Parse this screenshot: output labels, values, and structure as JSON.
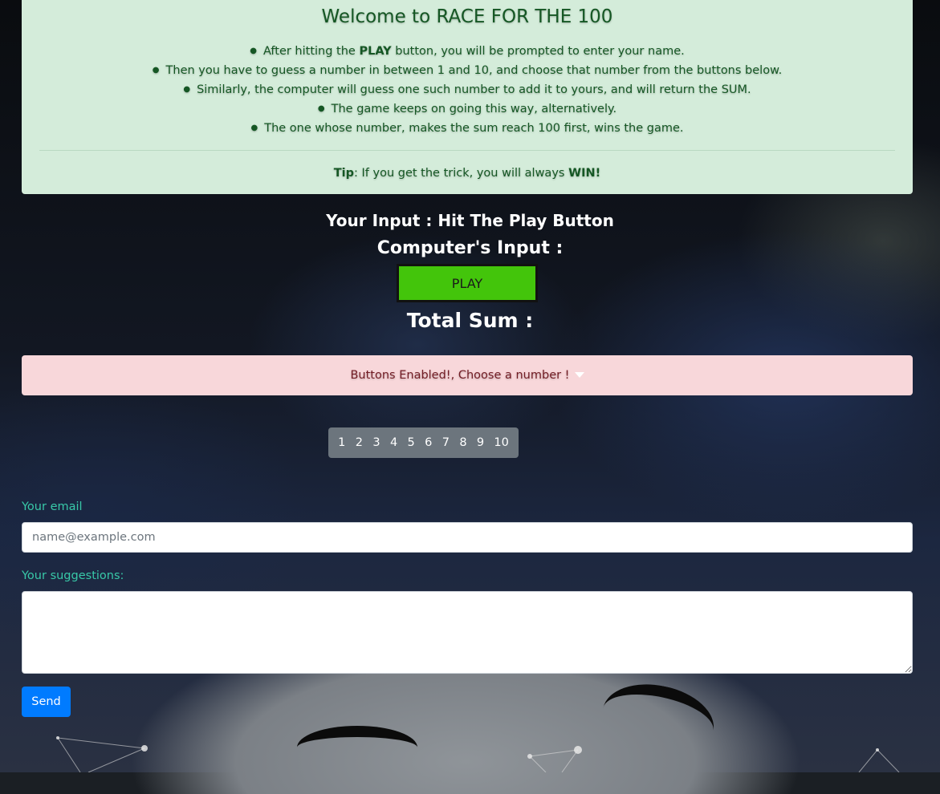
{
  "info": {
    "title": "Welcome to RACE FOR THE 100",
    "rules": [
      {
        "pre": "After hitting the ",
        "bold": "PLAY",
        "post": " button, you will be prompted to enter your name."
      },
      {
        "pre": "Then you have to guess a number in between 1 and 10, and choose that number from the buttons below.",
        "bold": "",
        "post": ""
      },
      {
        "pre": "Similarly, the computer will guess one such number to add it to yours, and will return the SUM.",
        "bold": "",
        "post": ""
      },
      {
        "pre": "The game keeps on going this way, alternatively.",
        "bold": "",
        "post": ""
      },
      {
        "pre": "The one whose number, makes the sum reach 100 first, wins the game.",
        "bold": "",
        "post": ""
      }
    ],
    "tip_label": "Tip",
    "tip_text": ": If you get the trick, you will always ",
    "tip_win": "WIN!"
  },
  "game": {
    "your_input": "Your Input : Hit The Play Button",
    "computer_input": "Computer's Input :",
    "play_label": "PLAY",
    "total_sum": "Total Sum :"
  },
  "alert": {
    "text": "Buttons Enabled!, Choose a number !"
  },
  "numbers": [
    "1",
    "2",
    "3",
    "4",
    "5",
    "6",
    "7",
    "8",
    "9",
    "10"
  ],
  "form": {
    "email_label": "Your email",
    "email_placeholder": "name@example.com",
    "email_value": "",
    "suggestions_label": "Your suggestions:",
    "suggestions_value": "",
    "send_label": "Send"
  },
  "colors": {
    "info_bg": "#d4ecda",
    "info_text": "#155724",
    "play_bg": "#43c50b",
    "alert_bg": "#f8d7da",
    "alert_text": "#721c24",
    "numgroup_bg": "#6c757d",
    "label_color": "#38c8a8",
    "send_bg": "#007bff"
  }
}
